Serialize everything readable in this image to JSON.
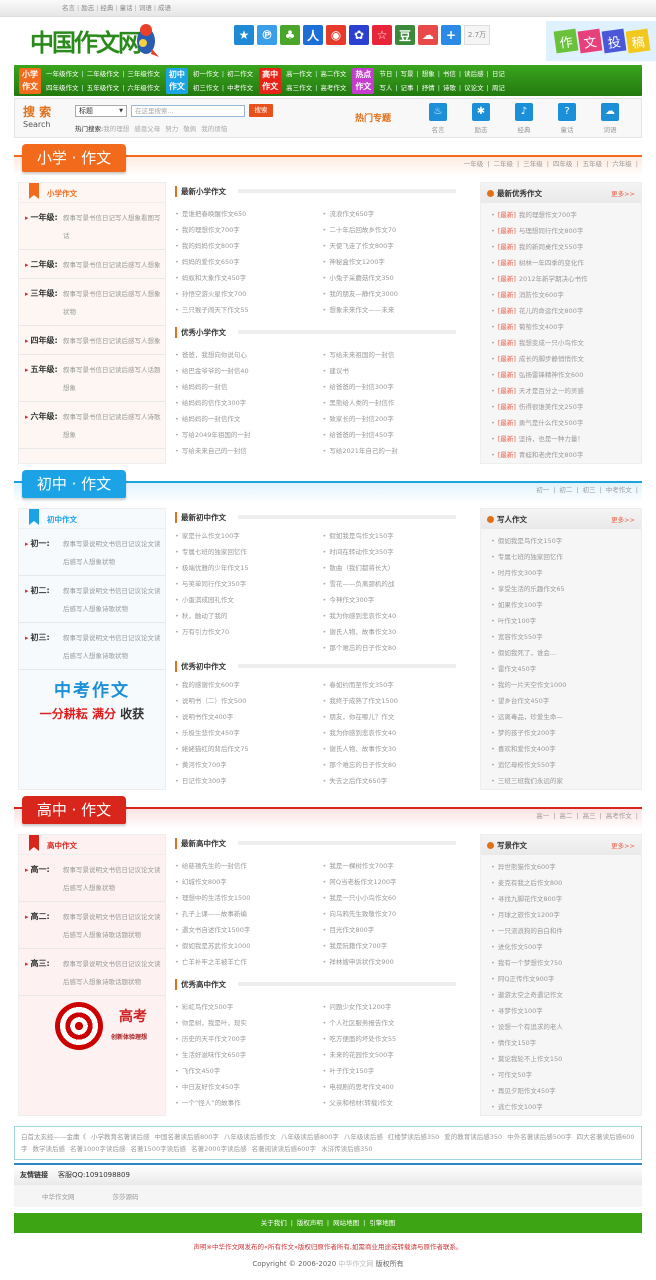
{
  "topbar": {
    "links": [
      "名言",
      "励志",
      "经典",
      "童话",
      "词语",
      "成语"
    ]
  },
  "header": {
    "logo": "中国作文网",
    "share_count": "2.7万",
    "share_icons": [
      "qzone-icon",
      "tencent-weibo-icon",
      "kaixin-icon",
      "renren-icon",
      "sina-weibo-icon",
      "baidu-icon",
      "qq-space-icon",
      "douban-icon",
      "feixin-icon",
      "plus-icon"
    ],
    "tougao": [
      "作",
      "文",
      "投",
      "稿"
    ]
  },
  "nav": {
    "groups": [
      {
        "badge": [
          "小学",
          "作文"
        ],
        "color": "#f26a1b",
        "rows": [
          [
            "一年级作文",
            "二年级作文",
            "三年级作文"
          ],
          [
            "四年级作文",
            "五年级作文",
            "六年级作文"
          ]
        ]
      },
      {
        "badge": [
          "初中",
          "作文"
        ],
        "color": "#1ba3e6",
        "rows": [
          [
            "初一作文",
            "初二作文"
          ],
          [
            "初三作文",
            "中考作文"
          ]
        ]
      },
      {
        "badge": [
          "高中",
          "作文"
        ],
        "color": "#e82418",
        "rows": [
          [
            "高一作文",
            "高二作文"
          ],
          [
            "高三作文",
            "高考作文"
          ]
        ]
      },
      {
        "badge": [
          "热点",
          "作文"
        ],
        "color": "#c53ccf",
        "rows": [
          [
            "节日",
            "写景",
            "想象",
            "书信",
            "读后感",
            "日记"
          ],
          [
            "写人",
            "记事",
            "抒情",
            "诗歌",
            "议论文",
            "周记"
          ]
        ]
      }
    ]
  },
  "search": {
    "title": "搜 索",
    "subtitle": "Search",
    "select": "标题",
    "placeholder": "在这里搜索...",
    "button": "搜索",
    "hot_label": "热门搜索:",
    "hot": [
      "我的理想",
      "感恩父母",
      "努力",
      "敬佩",
      "我的烦恼"
    ],
    "topic_title": "热门专题",
    "topics": [
      "名言",
      "励志",
      "经典",
      "童话",
      "词语"
    ]
  },
  "sections": [
    {
      "title": "小学 · 作文",
      "color": "#f26a1b",
      "grades": [
        "一年级",
        "二年级",
        "三年级",
        "四年级",
        "五年级",
        "六年级"
      ],
      "left_title": "小学作文",
      "left_bg": "#fdf6f2",
      "left": [
        {
          "name": "一年级:",
          "tags": [
            "叙事",
            "写景",
            "书信",
            "日记",
            "写人",
            "想象",
            "看图写话"
          ]
        },
        {
          "name": "二年级:",
          "tags": [
            "叙事",
            "写景",
            "书信",
            "日记",
            "读后感",
            "写人",
            "想象"
          ]
        },
        {
          "name": "三年级:",
          "tags": [
            "叙事",
            "写景",
            "书信",
            "日记",
            "读后感",
            "写人",
            "想象",
            "状物"
          ]
        },
        {
          "name": "四年级:",
          "tags": [
            "叙事",
            "写景",
            "书信",
            "日记",
            "读后感",
            "写人",
            "想象"
          ]
        },
        {
          "name": "五年级:",
          "tags": [
            "叙事",
            "写景",
            "书信",
            "日记",
            "读后感",
            "写人",
            "话题",
            "想象"
          ]
        },
        {
          "name": "六年级:",
          "tags": [
            "叙事",
            "写景",
            "书信",
            "日记",
            "读后感",
            "写人",
            "诗歌",
            "想象"
          ]
        }
      ],
      "blocks": [
        {
          "title": "最新小学作文",
          "col1": [
            "是谁把春唤醒作文650",
            "我的理想作文700字",
            "我的妈妈作文800字",
            "妈妈的爱作文650字",
            "蚂蚁和大象作文450字",
            "孙悟空游火星作文700",
            "三只猴子闹天下作文55"
          ],
          "col2": [
            "流浪作文650字",
            "二十年后回故乡作文70",
            "天使飞走了作文800字",
            "神秘盒作文1200字",
            "小兔子采蘑菇作文350",
            "我的朋友—静作文3000",
            "想象未来作文——未来"
          ]
        },
        {
          "title": "优秀小学作文",
          "col1": [
            "爸爸，我想向你说句心",
            "给巴金爷爷的一封信40",
            "给妈妈的一封信",
            "给妈妈的信作文300字",
            "给妈妈的一封信作文",
            "写给2049年祖国的一封",
            "写给未来自己的一封信"
          ],
          "col2": [
            "写给未来祖国的一封信",
            "建议书",
            "给爸爸的一封信300字",
            "黑熊给人类的一封信作",
            "致家长的一封信200字",
            "给爸爸的一封信450字",
            "写给2021年自己的一封"
          ]
        }
      ],
      "right_title": "最新优秀作文",
      "more": "更多>>",
      "tag": "[最新]",
      "right": [
        "我的理想作文700字",
        "与理想同行作文800字",
        "我的新同桌作文550字",
        "树林一年四季的变化作",
        "2012年新学期决心书作",
        "消防作文600字",
        "花儿的命运作文800字",
        "葡萄作文400字",
        "我想变成一只小鸟作文",
        "成长的脚步静悄悄作文",
        "弘扬雷锋精神作文600",
        "天才是百分之一的灵感",
        "伤得很谁美作文250字",
        "勇气是什么作文500字",
        "坚持，也是一种力量！",
        "青蛙和老虎作文800字"
      ]
    },
    {
      "title": "初中 · 作文",
      "color": "#1ba3e6",
      "grades": [
        "初一",
        "初二",
        "初三",
        "中考作文"
      ],
      "left_title": "初中作文",
      "left_bg": "#f6fafd",
      "left": [
        {
          "name": "初一:",
          "tags": [
            "叙事",
            "写景",
            "说明文",
            "书信",
            "日记",
            "议论文",
            "读后感",
            "写人",
            "想象",
            "状物"
          ]
        },
        {
          "name": "初二:",
          "tags": [
            "叙事",
            "写景",
            "说明文",
            "书信",
            "日记",
            "议论文",
            "读后感",
            "写人",
            "想象",
            "诗歌",
            "状物"
          ]
        },
        {
          "name": "初三:",
          "tags": [
            "叙事",
            "写景",
            "说明文",
            "书信",
            "日记",
            "议论文",
            "读后感",
            "写人",
            "想象",
            "诗歌",
            "状物"
          ]
        }
      ],
      "promo": {
        "line1": "中考作文",
        "line2a": "一分耕耘",
        "line2b": "满分",
        "line2c": "收获"
      },
      "blocks": [
        {
          "title": "最新初中作文",
          "col1": [
            "家是什么作文100字",
            "专属七班的独家回忆作",
            "极端优雅的少年作文15",
            "与笑单同行作文350字",
            "小蛋淇成园礼作文",
            "秋，触动了我的",
            "万有引力作文70"
          ],
          "col2": [
            "假如我是鸟作文150字",
            "时间在转动作文350字",
            "散曲（我们都将长大）",
            "雪花——负离颈机的战",
            "今神作文300字",
            "我为你感到悲哀作文40",
            "谢氏人物、故事作文30",
            "那个难忘的日子作文80"
          ]
        },
        {
          "title": "优秀初中作文",
          "col1": [
            "我的感谢作文600字",
            "说明书（二）作文500",
            "说明书作文400字",
            "乐极生悲作文450字",
            "姥姥猫红的背后作文75",
            "黄河作文700字",
            "日记作文300字"
          ],
          "col2": [
            "春如约而至作文350字",
            "我终于成熟了作文1500",
            "朋友，你在哪儿？作文",
            "我为你感到悲哀作文40",
            "谢氏人物、故事作文30",
            "那个难忘的日子作文80",
            "失去之后作文650字"
          ]
        }
      ],
      "right_title": "写人作文",
      "more": "更多>>",
      "right": [
        "假如我是鸟作文150字",
        "专属七班的独家回忆作",
        "时月作文300字",
        "享受生活的乐趣作文65",
        "如果作文100字",
        "叶作文100字",
        "宽容作文550字",
        "假如我死了，谁会...",
        "雷作文450字",
        "我的一片天空作文1000",
        "望乡台作文450字",
        "远离毒品，珍爱生命—",
        "梦的孩子作文200字",
        "喜欢和爱作文400字",
        "追忆母校作文550字",
        "三班三班我们永远的家"
      ]
    },
    {
      "title": "高中 · 作文",
      "color": "#d8261c",
      "grades": [
        "高一",
        "高二",
        "高三",
        "高考作文"
      ],
      "left_title": "高中作文",
      "left_bg": "#fdf1f2",
      "left": [
        {
          "name": "高一:",
          "tags": [
            "叙事",
            "写景",
            "说明文",
            "书信",
            "日记",
            "议论文",
            "读后感",
            "写人",
            "想象",
            "状物"
          ]
        },
        {
          "name": "高二:",
          "tags": [
            "叙事",
            "写景",
            "说明文",
            "书信",
            "日记",
            "议论文",
            "读后感",
            "写人",
            "想象",
            "诗歌",
            "话题",
            "状物"
          ]
        },
        {
          "name": "高三:",
          "tags": [
            "叙事",
            "写景",
            "说明文",
            "书信",
            "日记",
            "议论文",
            "读后感",
            "写人",
            "想象",
            "诗歌",
            "话题",
            "状物"
          ]
        }
      ],
      "promo": {
        "title": "高考",
        "sub": "创新体验理想"
      },
      "blocks": [
        {
          "title": "最新高中作文",
          "col1": [
            "给慈禧先生的一封信作",
            "幻城作文800字",
            "理想中的生活作文1500",
            "孔子上课——故事新编",
            "遇文书自述作文1500字",
            "假如我是苏武作文1000",
            "亡羊补牢之羊被羊亡作"
          ],
          "col2": [
            "我是一棵树作文700字",
            "阿Q当老板作文1200字",
            "我是一只小小鸟作文60",
            "向乌鸦先生致敬作文70",
            "目光作文800字",
            "我是阮籍作文700字",
            "祥林嫂申诉状作文900"
          ]
        },
        {
          "title": "优秀高中作文",
          "col1": [
            "彩虹鸟作文500字",
            "你是树，我是叶，现实",
            "历史的天平作文700字",
            "生活好滋味作文650字",
            "飞作文450字",
            "中日友好作文450字",
            "一个“怪人”的故事作"
          ],
          "col2": [
            "问题少女作文1200字",
            "个人社区服务报告作文",
            "吃方便面的坏处作文55",
            "未来的花园作文500字",
            "叶子作文150字",
            "电视剧的思考作文400",
            "父亲和棺材(转载)作文"
          ]
        }
      ],
      "right_title": "写景作文",
      "more": "更多>>",
      "right": [
        "异世熊猫作文600字",
        "麦克有我之后作文800",
        "寻找九脚花作文800字",
        "月球之旅作文1200字",
        "一只流浪狗的自白和件",
        "进化作文500字",
        "我有一个梦想作文750",
        "阿Q正传作文900字",
        "遨游太空之奇遇记作文",
        "寻梦作文100字",
        "设想一个有追求的老人",
        "情作文150字",
        "莫论我轮不上作文150",
        "可作文50字",
        "再见夕阳作文450字",
        "逃亡作文100字"
      ]
    }
  ],
  "tags": [
    "白首太玄经——金庸《",
    "小学教育名著读后感",
    "中国名著读后感800字",
    "八年级读后感作文",
    "八年级读后感800字",
    "八年级读后感",
    "红楼梦读后感350",
    "爱的教育读后感350",
    "中外名著读后感500字",
    "四大名著读后感600字",
    "数学读后感",
    "名著1000字读后感",
    "名著1500字读后感",
    "名著2000字读后感",
    "名著阅读读后感600字",
    "水浒传读后感350"
  ],
  "friends": {
    "title": "友情链接",
    "qq": "客服QQ:1091098809",
    "links": [
      "中华作文网",
      "莎莎源码"
    ]
  },
  "footer": {
    "links": [
      "关于我们",
      "版权声明",
      "网站地图",
      "引擎地图"
    ],
    "declaration": "声明※中华作文网发布的«所有作文»版权归原作者所有,如需商业用途或转载请与原作者联系。",
    "copyright": "Copyright © 2006-2020",
    "site": "中华作文网",
    "rights": "版权所有"
  }
}
